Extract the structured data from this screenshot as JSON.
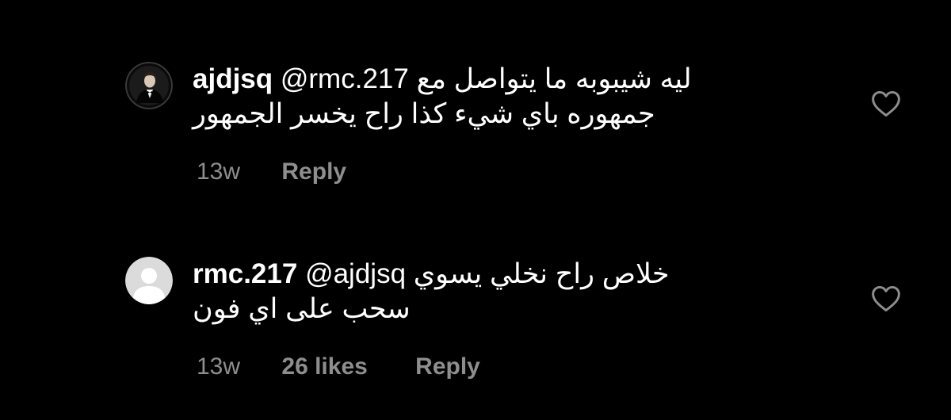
{
  "comments": [
    {
      "avatar": "profile-photo-tuxedo",
      "username": "ajdjsq",
      "mention": "@rmc.217",
      "text_line1": "ليه شيبوبه ما يتواصل مع",
      "text_line2": "جمهوره باي  شيء كذا راح يخسر الجمهور",
      "time": "13w",
      "likes": "",
      "reply_label": "Reply",
      "like_icon": "heart-outline-icon"
    },
    {
      "avatar": "default-avatar",
      "username": "rmc.217",
      "mention": "@ajdjsq",
      "text_line1": "خلاص راح نخلي يسوي",
      "text_line2": "سحب على اي فون",
      "time": "13w",
      "likes": "26 likes",
      "reply_label": "Reply",
      "like_icon": "heart-outline-icon"
    }
  ],
  "colors": {
    "background": "#000000",
    "text": "#ffffff",
    "meta": "#8e8e8e",
    "avatar_ring": "#3a3a3a",
    "default_avatar": "#dbdbdb"
  }
}
